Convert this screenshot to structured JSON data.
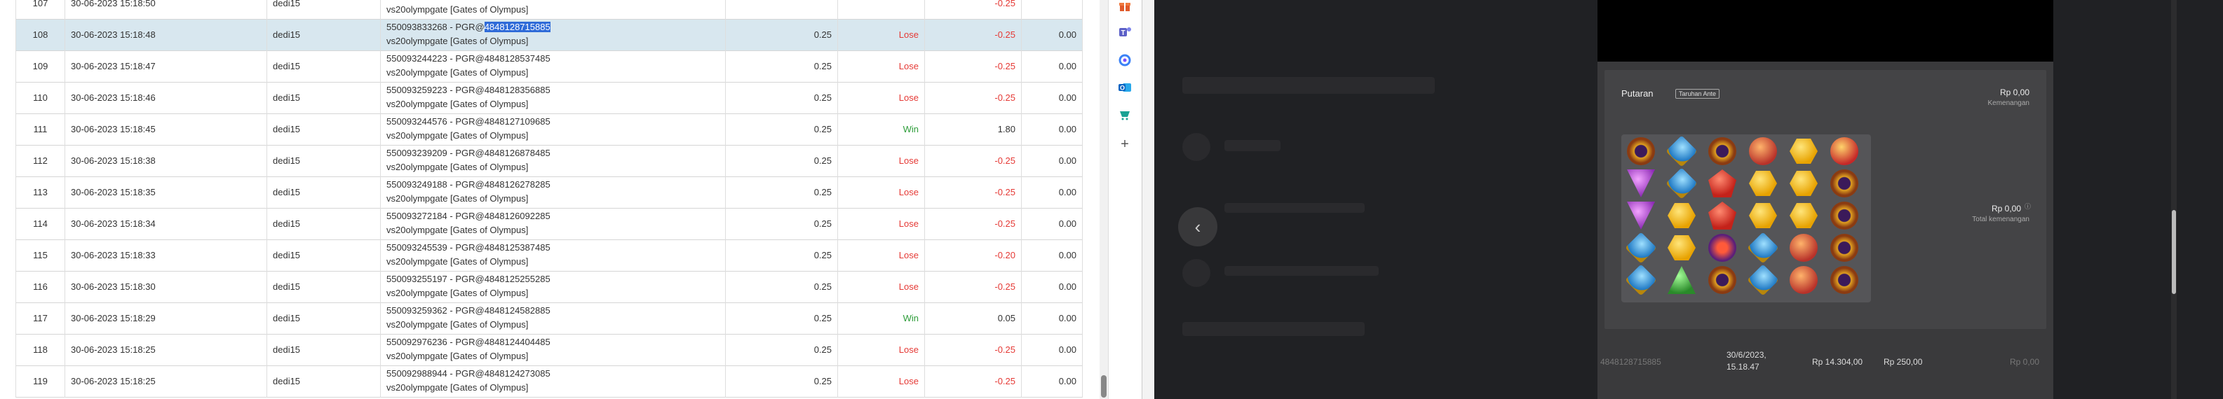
{
  "report": {
    "partial_top": {
      "number": "107",
      "datetime": "30-06-2023 15:18:50",
      "user": "dedi15",
      "desc_line2": "vs20olympgate [Gates of Olympus]",
      "winlose": "-0.25"
    },
    "rows": [
      {
        "number": "108",
        "datetime": "30-06-2023 15:18:48",
        "user": "dedi15",
        "desc_prefix": "550093833268 - PGR@",
        "desc_id": "4848128715885",
        "desc_line2": "vs20olympgate [Gates of Olympus]",
        "bet": "0.25",
        "result": "Lose",
        "winlose": "-0.25",
        "jackpot": "0.00"
      },
      {
        "number": "109",
        "datetime": "30-06-2023 15:18:47",
        "user": "dedi15",
        "desc_prefix": "550093244223 - PGR@",
        "desc_id": "4848128537485",
        "desc_line2": "vs20olympgate [Gates of Olympus]",
        "bet": "0.25",
        "result": "Lose",
        "winlose": "-0.25",
        "jackpot": "0.00"
      },
      {
        "number": "110",
        "datetime": "30-06-2023 15:18:46",
        "user": "dedi15",
        "desc_prefix": "550093259223 - PGR@",
        "desc_id": "4848128356885",
        "desc_line2": "vs20olympgate [Gates of Olympus]",
        "bet": "0.25",
        "result": "Lose",
        "winlose": "-0.25",
        "jackpot": "0.00"
      },
      {
        "number": "111",
        "datetime": "30-06-2023 15:18:45",
        "user": "dedi15",
        "desc_prefix": "550093244576 - PGR@",
        "desc_id": "4848127109685",
        "desc_line2": "vs20olympgate [Gates of Olympus]",
        "bet": "0.25",
        "result": "Win",
        "winlose": "1.80",
        "jackpot": "0.00"
      },
      {
        "number": "112",
        "datetime": "30-06-2023 15:18:38",
        "user": "dedi15",
        "desc_prefix": "550093239209 - PGR@",
        "desc_id": "4848126878485",
        "desc_line2": "vs20olympgate [Gates of Olympus]",
        "bet": "0.25",
        "result": "Lose",
        "winlose": "-0.25",
        "jackpot": "0.00"
      },
      {
        "number": "113",
        "datetime": "30-06-2023 15:18:35",
        "user": "dedi15",
        "desc_prefix": "550093249188 - PGR@",
        "desc_id": "4848126278285",
        "desc_line2": "vs20olympgate [Gates of Olympus]",
        "bet": "0.25",
        "result": "Lose",
        "winlose": "-0.25",
        "jackpot": "0.00"
      },
      {
        "number": "114",
        "datetime": "30-06-2023 15:18:34",
        "user": "dedi15",
        "desc_prefix": "550093272184 - PGR@",
        "desc_id": "4848126092285",
        "desc_line2": "vs20olympgate [Gates of Olympus]",
        "bet": "0.25",
        "result": "Lose",
        "winlose": "-0.25",
        "jackpot": "0.00"
      },
      {
        "number": "115",
        "datetime": "30-06-2023 15:18:33",
        "user": "dedi15",
        "desc_prefix": "550093245539 - PGR@",
        "desc_id": "4848125387485",
        "desc_line2": "vs20olympgate [Gates of Olympus]",
        "bet": "0.25",
        "result": "Lose",
        "winlose": "-0.20",
        "jackpot": "0.00"
      },
      {
        "number": "116",
        "datetime": "30-06-2023 15:18:30",
        "user": "dedi15",
        "desc_prefix": "550093255197 - PGR@",
        "desc_id": "4848125255285",
        "desc_line2": "vs20olympgate [Gates of Olympus]",
        "bet": "0.25",
        "result": "Lose",
        "winlose": "-0.25",
        "jackpot": "0.00"
      },
      {
        "number": "117",
        "datetime": "30-06-2023 15:18:29",
        "user": "dedi15",
        "desc_prefix": "550093259362 - PGR@",
        "desc_id": "4848124582885",
        "desc_line2": "vs20olympgate [Gates of Olympus]",
        "bet": "0.25",
        "result": "Win",
        "winlose": "0.05",
        "jackpot": "0.00"
      },
      {
        "number": "118",
        "datetime": "30-06-2023 15:18:25",
        "user": "dedi15",
        "desc_prefix": "550092976236 - PGR@",
        "desc_id": "4848124404485",
        "desc_line2": "vs20olympgate [Gates of Olympus]",
        "bet": "0.25",
        "result": "Lose",
        "winlose": "-0.25",
        "jackpot": "0.00"
      },
      {
        "number": "119",
        "datetime": "30-06-2023 15:18:25",
        "user": "dedi15",
        "desc_prefix": "550092988944 - PGR@",
        "desc_id": "4848124273085",
        "desc_line2": "vs20olympgate [Gates of Olympus]",
        "bet": "0.25",
        "result": "Lose",
        "winlose": "-0.25",
        "jackpot": "0.00"
      }
    ]
  },
  "sidebar": {
    "icons": [
      {
        "name": "gift-icon",
        "color": "#e05a2b"
      },
      {
        "name": "teams-icon",
        "color": "#5b5fc7"
      },
      {
        "name": "settings-app-icon",
        "color": "#3b82f6"
      },
      {
        "name": "outlook-icon",
        "color": "#0a64c2"
      },
      {
        "name": "shopping-icon",
        "color": "#1aa394"
      },
      {
        "name": "add-icon",
        "color": "#555555"
      }
    ]
  },
  "game": {
    "title": "Putaran",
    "bet_badge": "Taruhan Ante",
    "win_amount": "Rp 0,00",
    "win_label": "Kemenangan",
    "total_amount": "Rp 0,00",
    "total_label": "Total kemenangan",
    "grid": [
      [
        "ring",
        "gem-blue",
        "ring",
        "cup",
        "gem-gold",
        "crown"
      ],
      [
        "tri-purple",
        "gem-blue",
        "gem-red",
        "gem-gold",
        "gem-gold",
        "ring"
      ],
      [
        "tri-purple",
        "gem-gold",
        "gem-red",
        "gem-gold",
        "gem-gold",
        "ring"
      ],
      [
        "gem-blue",
        "gem-gold",
        "scatter",
        "gem-blue",
        "cup",
        "ring"
      ],
      [
        "gem-blue",
        "gem-green",
        "ring",
        "gem-blue",
        "cup",
        "ring"
      ]
    ],
    "footer": {
      "round_id": "4848128715885",
      "date": "30/6/2023,",
      "time": "15.18.47",
      "balance": "Rp 14.304,00",
      "bet": "Rp 250,00",
      "win": "Rp 0,00"
    }
  }
}
